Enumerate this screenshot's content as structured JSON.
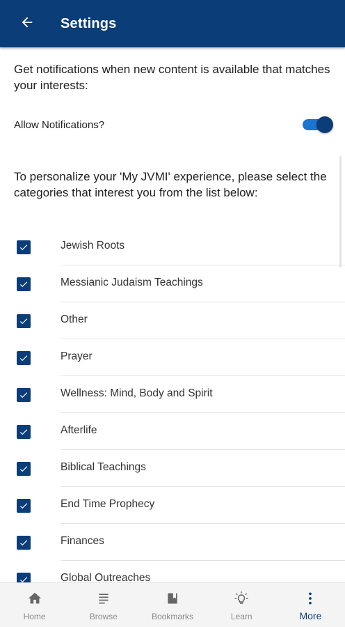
{
  "app_bar": {
    "title": "Settings",
    "back_icon": "arrow-left-icon",
    "background": "#0b3d78"
  },
  "intro": {
    "text": "Get notifications when new content is available that matches your interests:"
  },
  "notifications": {
    "label": "Allow Notifications?",
    "enabled": true,
    "toggle_on_color": "#1b74d1"
  },
  "personalize": {
    "text": "To personalize your 'My JVMI' experience, please select the categories that interest you from the list below:"
  },
  "categories": [
    {
      "label": "Jewish Roots",
      "checked": true
    },
    {
      "label": "Messianic Judaism Teachings",
      "checked": true
    },
    {
      "label": "Other",
      "checked": true
    },
    {
      "label": "Prayer",
      "checked": true
    },
    {
      "label": "Wellness: Mind, Body and Spirit",
      "checked": true
    },
    {
      "label": "Afterlife",
      "checked": true
    },
    {
      "label": "Biblical Teachings",
      "checked": true
    },
    {
      "label": "End Time Prophecy",
      "checked": true
    },
    {
      "label": "Finances",
      "checked": true
    },
    {
      "label": "Global Outreaches",
      "checked": true
    }
  ],
  "bottom_nav": {
    "items": [
      {
        "label": "Home",
        "icon": "home-icon",
        "active": false
      },
      {
        "label": "Browse",
        "icon": "browse-icon",
        "active": false
      },
      {
        "label": "Bookmarks",
        "icon": "bookmark-icon",
        "active": false
      },
      {
        "label": "Learn",
        "icon": "lightbulb-icon",
        "active": false
      },
      {
        "label": "More",
        "icon": "more-vertical-icon",
        "active": true
      }
    ],
    "active_color": "#0b3d78",
    "inactive_color": "#8a8a8a"
  }
}
